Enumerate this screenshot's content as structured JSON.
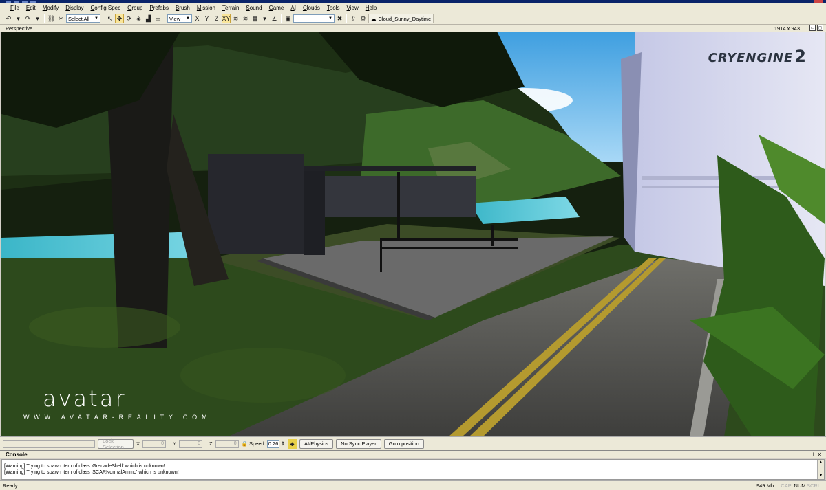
{
  "menu": [
    "File",
    "Edit",
    "Modify",
    "Display",
    "Config Spec",
    "Group",
    "Prefabs",
    "Brush",
    "Mission",
    "Terrain",
    "Sound",
    "Game",
    "AI",
    "Clouds",
    "Tools",
    "View",
    "Help"
  ],
  "toolbar": {
    "select_combo": "Select All",
    "view_combo": "View",
    "axis_x": "X",
    "axis_y": "Y",
    "axis_z": "Z",
    "axis_xy": "XY",
    "environment": "Cloud_Sunny_Daytime"
  },
  "viewport": {
    "title": "Perspective",
    "resolution": "1914 x 943",
    "engine_logo": "CRYENGINE",
    "engine_version": "2",
    "watermark_logo": "avatar",
    "watermark_url": "WWW.AVATAR-REALITY.COM"
  },
  "position_bar": {
    "lock_selection": "Lock Selection",
    "x_label": "X",
    "x_value": "0",
    "y_label": "Y",
    "y_value": "0",
    "z_label": "Z",
    "z_value": "0",
    "speed_label": "Speed:",
    "speed_value": "0.26",
    "ai_physics": "AI/Physics",
    "no_sync_player": "No Sync Player",
    "goto_position": "Goto position"
  },
  "console": {
    "title": "Console",
    "lines": [
      "[Warning] Trying to spawn item of class 'GrenadeShell' which is unknown!",
      "[Warning] Trying to spawn item of class 'SCARNormalAmmo' which is unknown!"
    ]
  },
  "status": {
    "text": "Ready",
    "memory": "949 Mb",
    "cap": "CAP",
    "num": "NUM",
    "scrl": "SCRL"
  }
}
